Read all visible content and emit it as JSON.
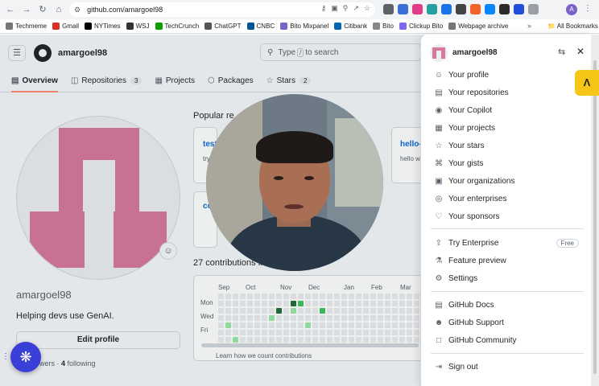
{
  "browser": {
    "url": "github.com/amargoel98",
    "bookmarks": [
      "Techmeme",
      "Gmail",
      "NYTimes",
      "WSJ",
      "TechCrunch",
      "ChatGPT",
      "CNBC",
      "Bito Mixpanel",
      "Citibank",
      "Bito",
      "Clickup Bito",
      "Webpage archive"
    ],
    "all_bookmarks": "All Bookmarks",
    "profile_initial": "A"
  },
  "header": {
    "username": "amargoel98",
    "search_placeholder_pre": "Type",
    "search_key": "/",
    "search_placeholder_post": "to search"
  },
  "tabs": [
    {
      "label": "Overview",
      "count": ""
    },
    {
      "label": "Repositories",
      "count": "3"
    },
    {
      "label": "Projects",
      "count": ""
    },
    {
      "label": "Packages",
      "count": ""
    },
    {
      "label": "Stars",
      "count": "2"
    }
  ],
  "profile": {
    "username": "amargoel98",
    "bio": "Helping devs use GenAI.",
    "edit_label": "Edit profile",
    "followers_label": "llowers",
    "following_count": "4",
    "following_label": "following"
  },
  "main": {
    "popular_title": "Popular re",
    "repos": [
      {
        "name": "test",
        "desc": "try"
      },
      {
        "name": "hello-",
        "desc": "hello w"
      },
      {
        "name": "co",
        "desc": ""
      }
    ],
    "contrib_title": "27 contributions in",
    "months": [
      "Sep",
      "Oct",
      "Nov",
      "Dec",
      "Jan",
      "Feb",
      "Mar"
    ],
    "days": [
      "Mon",
      "Wed",
      "Fri"
    ],
    "learn_link": "Learn how we count contributions"
  },
  "menu": {
    "username": "amargoel98",
    "group1": [
      "Your profile",
      "Your repositories",
      "Your Copilot",
      "Your projects",
      "Your stars",
      "Your gists",
      "Your organizations",
      "Your enterprises",
      "Your sponsors"
    ],
    "group2": [
      "Try Enterprise",
      "Feature preview",
      "Settings"
    ],
    "free_badge": "Free",
    "group3": [
      "GitHub Docs",
      "GitHub Support",
      "GitHub Community"
    ],
    "sign_out": "Sign out"
  },
  "colors": {
    "accent": "#0969da",
    "avatar_pink": "#d8789e",
    "tab_underline": "#fd8c73",
    "fab": "#3a3fd8"
  }
}
